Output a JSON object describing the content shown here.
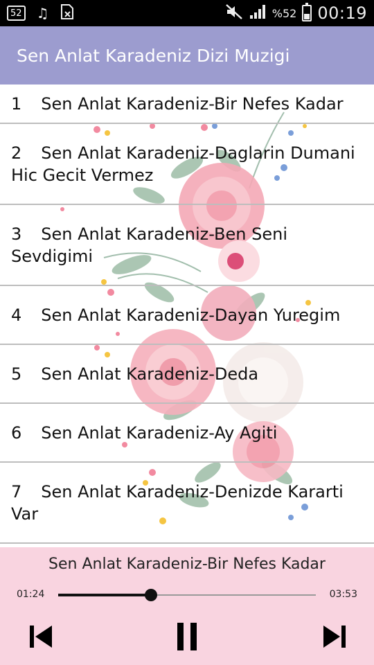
{
  "status_bar": {
    "notif_badge": "52",
    "battery_text": "%52",
    "battery_level": 0.52,
    "clock": "00:19",
    "icons": [
      "message-icon",
      "music-note-icon",
      "sim-off-icon",
      "mute-icon",
      "signal-icon",
      "battery-icon"
    ]
  },
  "app_bar": {
    "title": "Sen Anlat Karadeniz Dizi Muzigi",
    "color": "#9c9ccf"
  },
  "tracks": [
    {
      "number": "1",
      "title": "Sen Anlat Karadeniz-Bir Nefes Kadar"
    },
    {
      "number": "2",
      "title": "Sen Anlat Karadeniz-Daglarin Dumani Hic Gecit Vermez"
    },
    {
      "number": "3",
      "title": "Sen Anlat Karadeniz-Ben Seni Sevdigimi"
    },
    {
      "number": "4",
      "title": "Sen Anlat Karadeniz-Dayan Yuregim"
    },
    {
      "number": "5",
      "title": "Sen Anlat Karadeniz-Deda"
    },
    {
      "number": "6",
      "title": "Sen Anlat Karadeniz-Ay Agiti"
    },
    {
      "number": "7",
      "title": "Sen Anlat Karadeniz-Denizde Kararti Var"
    }
  ],
  "player": {
    "now_playing": "Sen Anlat Karadeniz-Bir Nefes Kadar",
    "current_time": "01:24",
    "total_time": "03:53",
    "progress": 0.36,
    "background": "#f9d4e0"
  }
}
